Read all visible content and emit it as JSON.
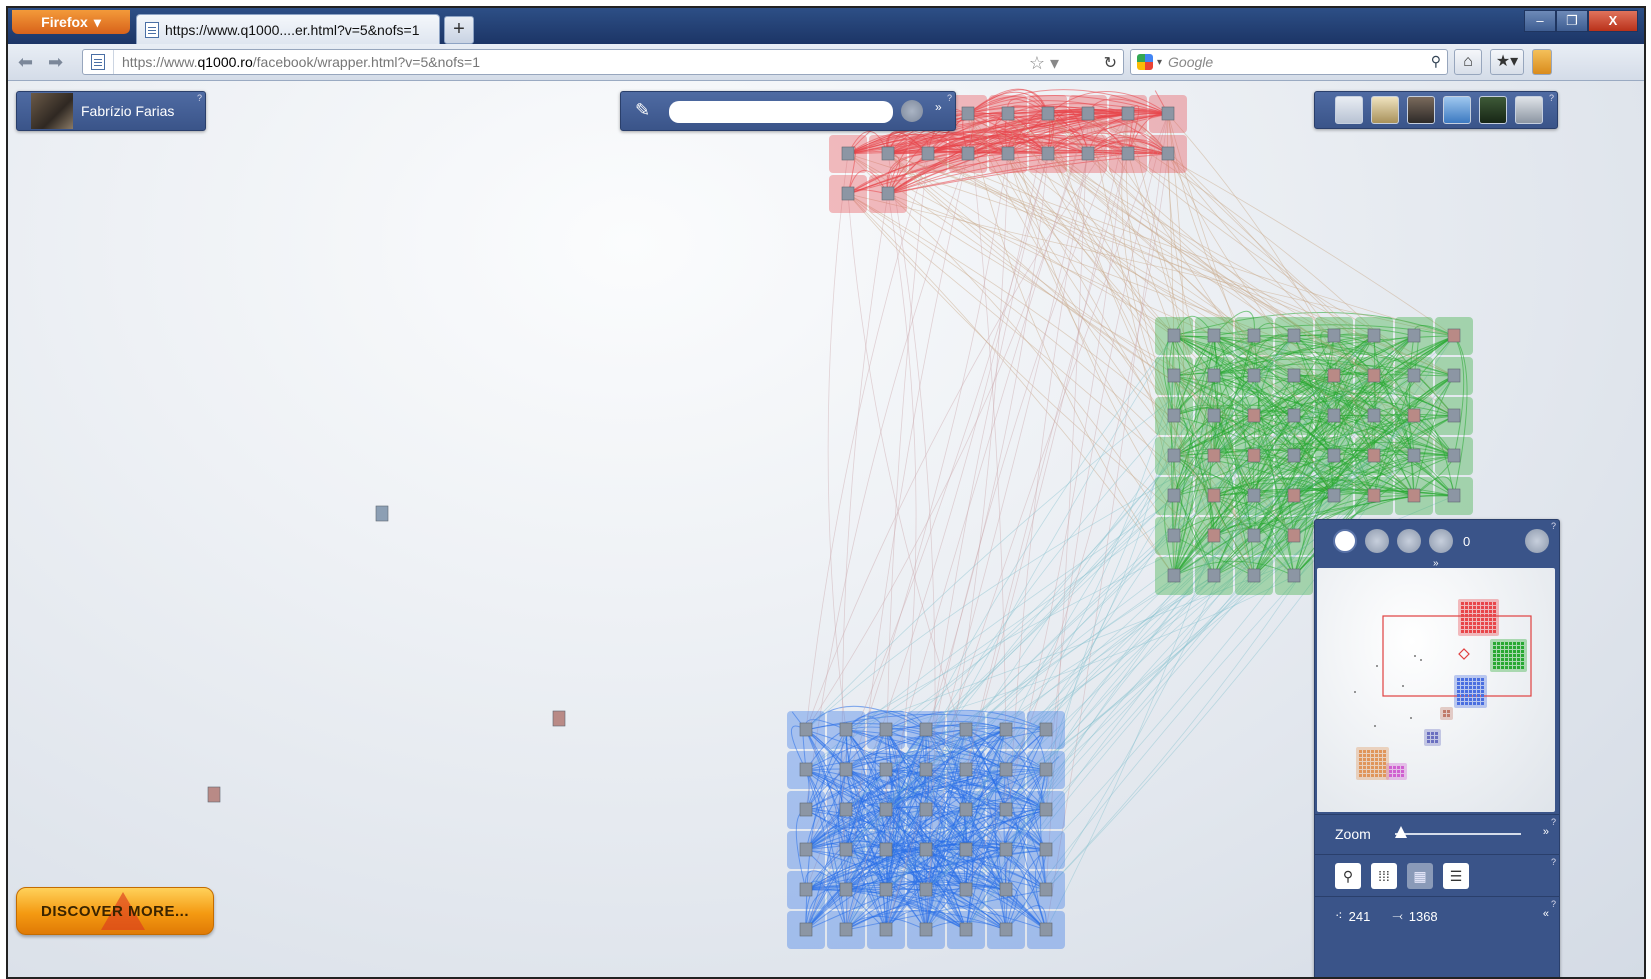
{
  "browser": {
    "menu_label": "Firefox",
    "tab_title": "https://www.q1000....er.html?v=5&nofs=1",
    "new_tab_label": "+",
    "url_prefix": "https://www.",
    "url_host": "q1000.ro",
    "url_path": "/facebook/wrapper.html?v=5&nofs=1",
    "search_engine": "Google",
    "window_buttons": [
      "–",
      "❐",
      "X"
    ]
  },
  "app": {
    "user_name": "Fabrízio Farias",
    "help_mark": "?",
    "minimap_count": "0",
    "zoom_label": "Zoom",
    "zoom_level": 0.0,
    "stats": {
      "nodes": "241",
      "edges": "1368"
    },
    "discover_label": "DISCOVER MORE...",
    "search_value": ""
  },
  "colors": {
    "red_cluster": "#e8454a",
    "green_cluster": "#28a832",
    "blue_cluster": "#2a6fe8",
    "panel": "#3f5a92",
    "accent_orange": "#f49a12"
  },
  "icons": [
    "firefox-menu-icon",
    "page-icon",
    "back-icon",
    "forward-icon",
    "bookmark-star-icon",
    "reload-icon",
    "google-icon",
    "search-icon",
    "home-icon",
    "bookmarks-icon",
    "pen-icon",
    "clear-icon",
    "expand-icon",
    "select-icon",
    "zoom-in-icon",
    "zoom-out-icon",
    "zoom-fit-icon",
    "close-icon",
    "search-node-icon",
    "grid-icon",
    "layout-icon",
    "list-icon",
    "nodes-icon",
    "edges-icon"
  ]
}
